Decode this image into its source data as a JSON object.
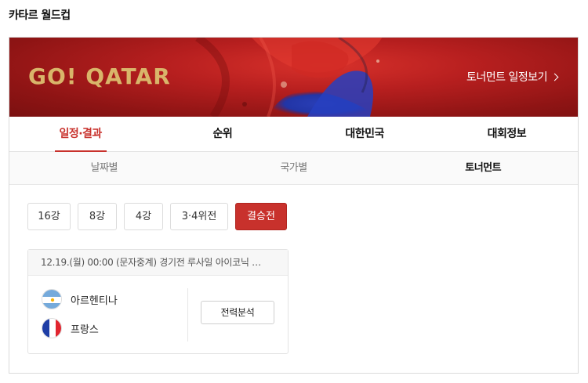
{
  "page": {
    "title": "카타르 월드컵"
  },
  "banner": {
    "logo_text": "GO! QATAR",
    "link_label": "토너먼트 일정보기"
  },
  "main_tabs": [
    {
      "label": "일정·결과",
      "active": true
    },
    {
      "label": "순위",
      "active": false
    },
    {
      "label": "대한민국",
      "active": false
    },
    {
      "label": "대회정보",
      "active": false
    }
  ],
  "sub_tabs": [
    {
      "label": "날짜별",
      "active": false
    },
    {
      "label": "국가별",
      "active": false
    },
    {
      "label": "토너먼트",
      "active": true
    }
  ],
  "rounds": [
    {
      "label": "16강",
      "active": false
    },
    {
      "label": "8강",
      "active": false
    },
    {
      "label": "4강",
      "active": false
    },
    {
      "label": "3·4위전",
      "active": false
    },
    {
      "label": "결승전",
      "active": true
    }
  ],
  "match": {
    "info": "12.19.(월) 00:00 (문자중계) 경기전   루사일 아이코닉 …",
    "team1": {
      "name": "아르헨티나",
      "flag": "argentina-flag"
    },
    "team2": {
      "name": "프랑스",
      "flag": "france-flag"
    },
    "analysis_label": "전력분석"
  },
  "colors": {
    "accent": "#c8312c",
    "banner_red": "#b71f1f",
    "logo_gold": "#d9b56a"
  }
}
